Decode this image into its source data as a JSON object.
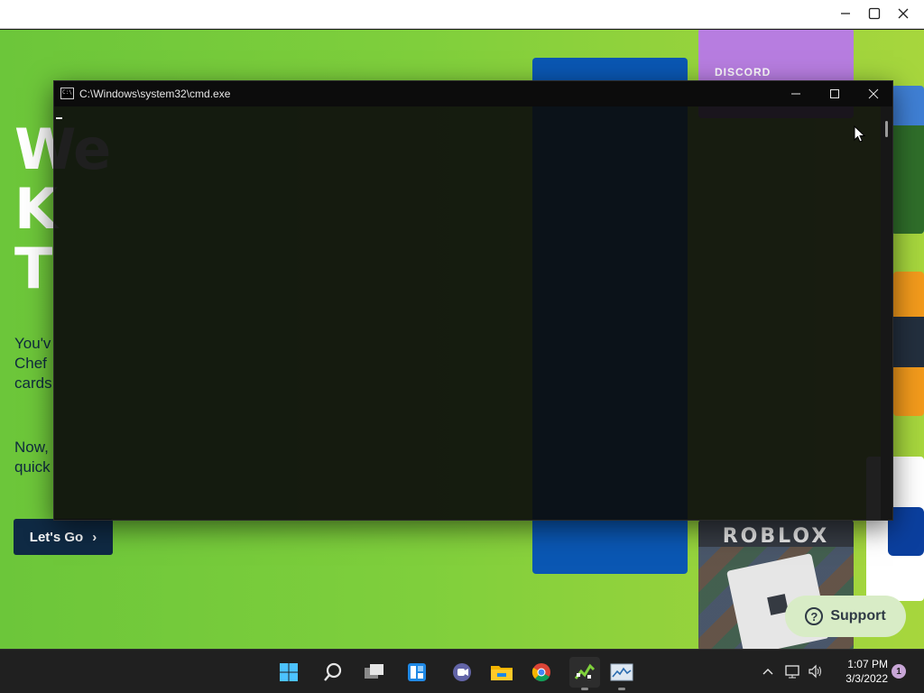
{
  "outer_window": {
    "controls": [
      "minimize",
      "maximize",
      "close"
    ]
  },
  "webpage": {
    "hero_title": "We\nK\nT",
    "hero_text_1": "You'v\nChef\ncards",
    "hero_text_2": "Now,\nquick",
    "cta_label": "Let's Go",
    "cta_chevron": "›",
    "cards": {
      "discord_label": "DISCORD",
      "roblox_label": "ROBLOX"
    },
    "support_label": "Support",
    "support_icon": "?"
  },
  "cmd_window": {
    "title": "C:\\Windows\\system32\\cmd.exe",
    "icon": "cmd-icon",
    "background": "#0c0c0c"
  },
  "taskbar": {
    "icons": [
      "windows-start-icon",
      "search-icon",
      "task-view-icon",
      "widgets-icon",
      "teams-chat-icon",
      "file-explorer-icon",
      "chrome-icon",
      "app-icon",
      "task-manager-icon"
    ],
    "tray": {
      "time": "1:07 PM",
      "date": "3/3/2022",
      "notification_count": "1"
    }
  },
  "colors": {
    "page_green": "#7fcf3c",
    "cta_navy": "#0f2a44",
    "cmd_bg": "#0c0c0c",
    "taskbar_bg": "#202020"
  }
}
